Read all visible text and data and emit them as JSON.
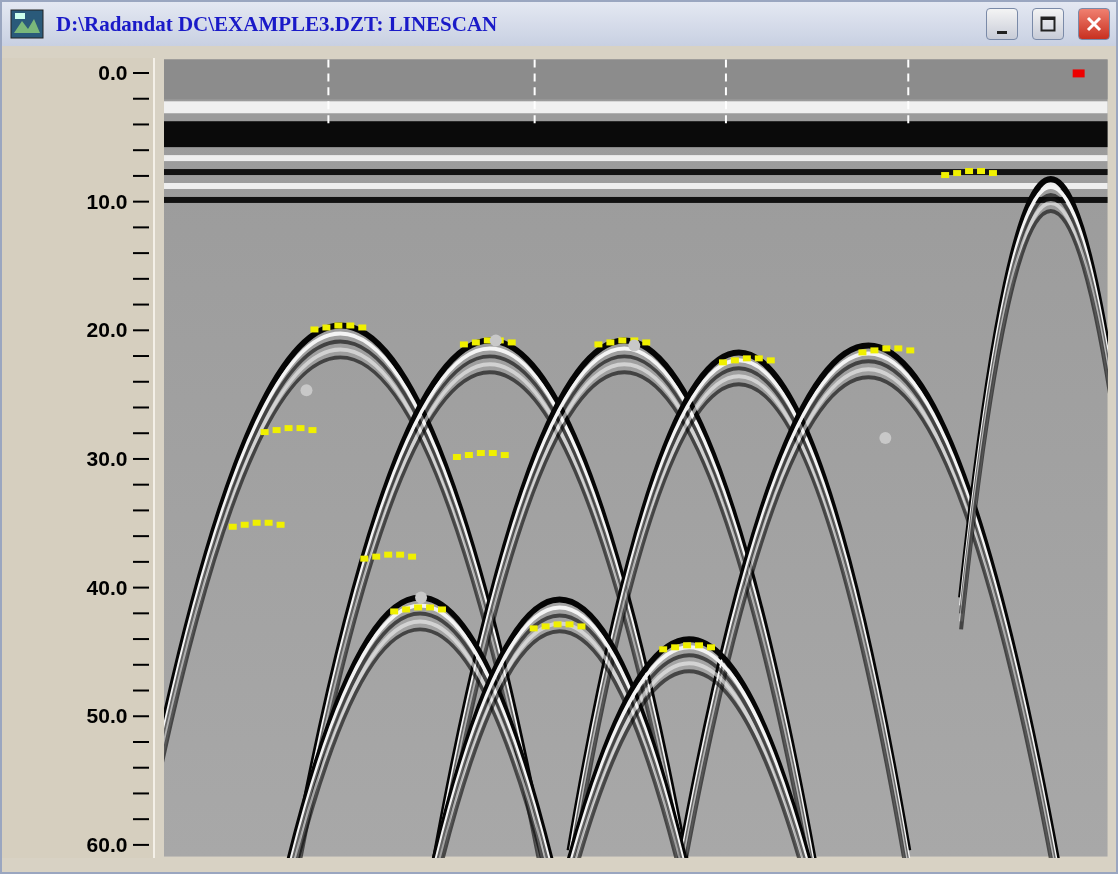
{
  "window": {
    "title": "D:\\Radandat DC\\EXAMPLE3.DZT:  LINESCAN"
  },
  "title_buttons": [
    {
      "kind": "minimize"
    },
    {
      "kind": "maximize"
    },
    {
      "kind": "close"
    }
  ],
  "depth_scale": {
    "labels": [
      "0.0",
      "10.0",
      "20.0",
      "30.0",
      "40.0",
      "50.0",
      "60.0"
    ]
  }
}
